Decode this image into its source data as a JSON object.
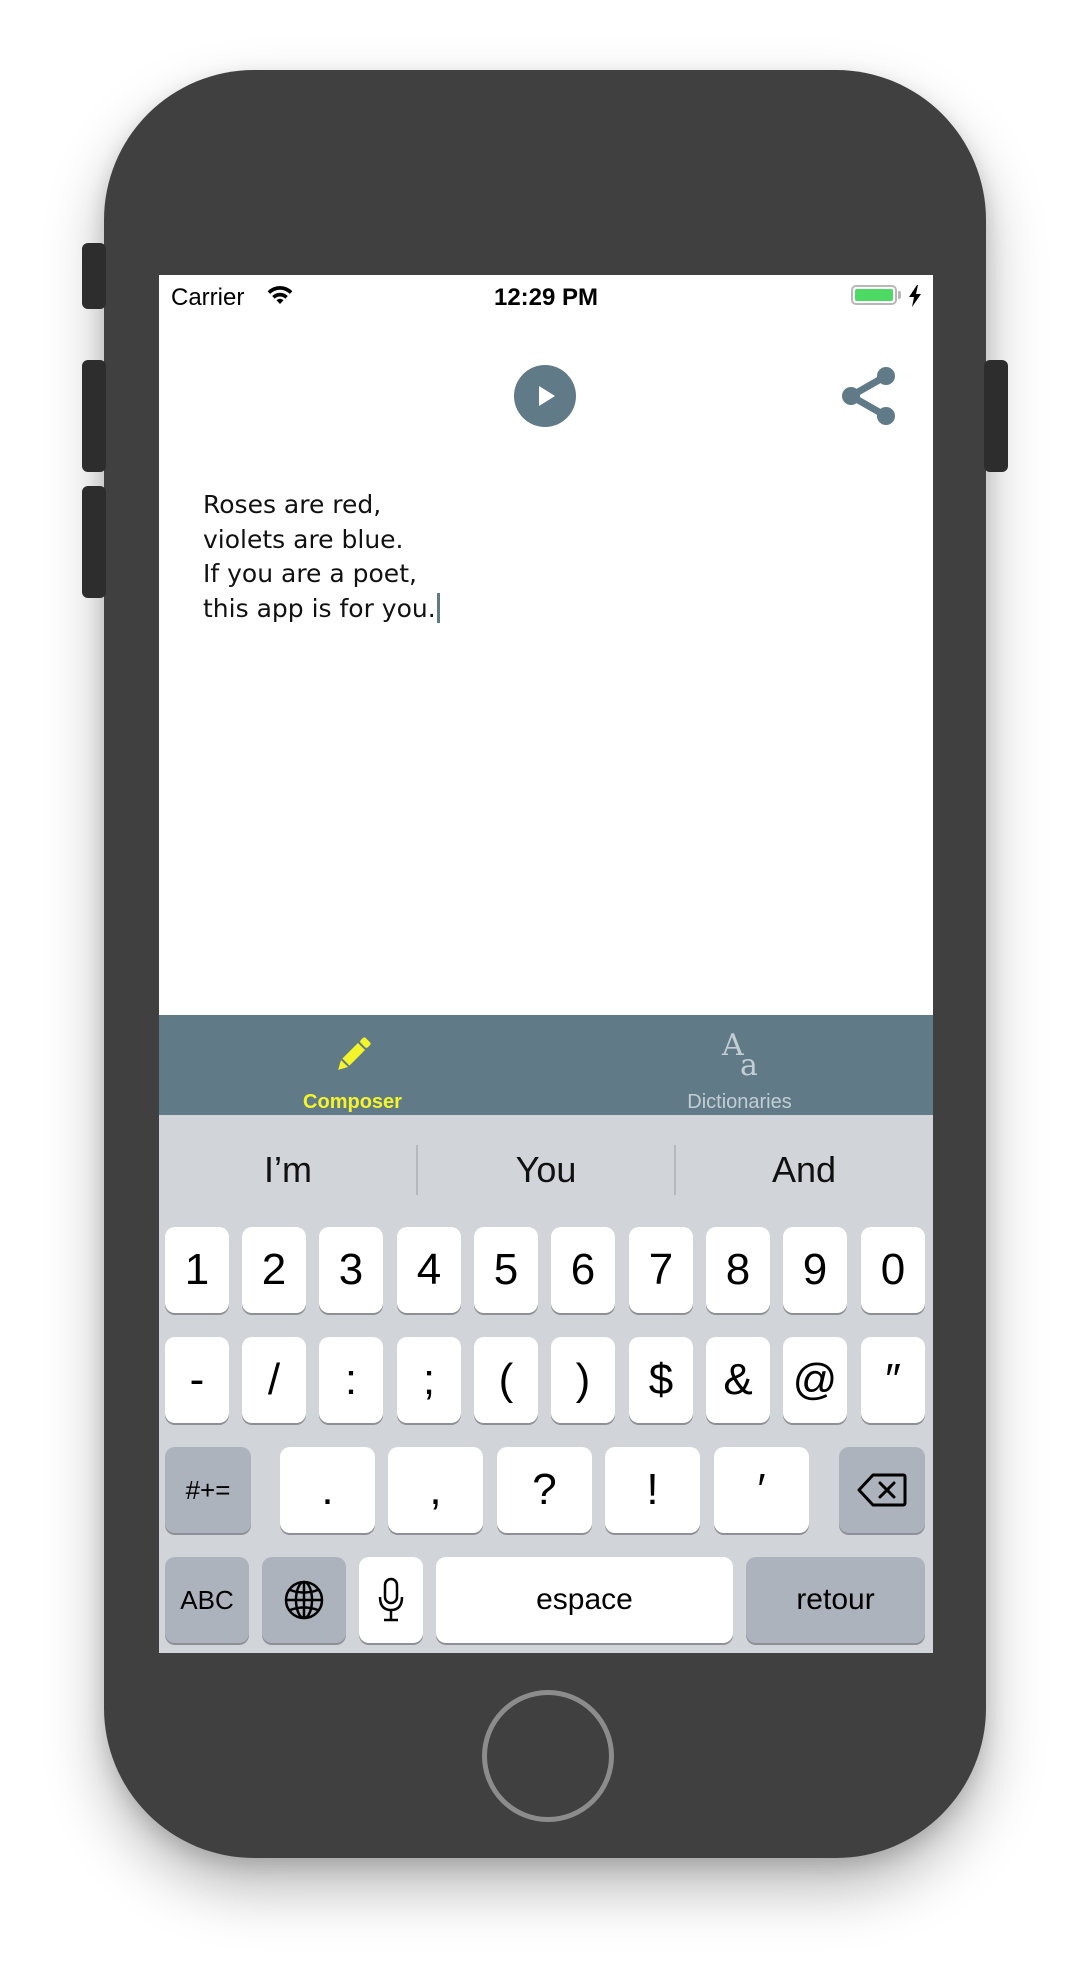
{
  "status_bar": {
    "carrier": "Carrier",
    "time": "12:29 PM",
    "wifi_icon": "wifi-icon",
    "battery_level": 1.0,
    "battery_color": "#4cd964",
    "charging_icon": "lightning-bolt-icon"
  },
  "toolbar": {
    "play_icon": "play-icon",
    "share_icon": "share-icon",
    "accent_color": "#617a87"
  },
  "composer": {
    "lines": [
      "Roses are red,",
      "violets are blue.",
      "If you are a poet,",
      "this app is for you."
    ]
  },
  "tab_bar": {
    "background": "#617a87",
    "active_color": "#f4f42a",
    "inactive_color": "#c3ced4",
    "tabs": [
      {
        "label": "Composer",
        "icon": "pencil-icon",
        "active": true
      },
      {
        "label": "Dictionaries",
        "icon": "font-size-icon",
        "icon_glyphs": [
          "A",
          "a"
        ],
        "active": false
      }
    ]
  },
  "keyboard": {
    "suggestions": [
      "I’m",
      "You",
      "And"
    ],
    "row1": [
      "1",
      "2",
      "3",
      "4",
      "5",
      "6",
      "7",
      "8",
      "9",
      "0"
    ],
    "row2": [
      "-",
      "/",
      ":",
      ";",
      "(",
      ")",
      "$",
      "&",
      "@",
      "″"
    ],
    "row3": {
      "shift_label": "#+=",
      "keys": [
        ".",
        ",",
        "?",
        "!",
        "′"
      ],
      "backspace_icon": "backspace-icon"
    },
    "row4": {
      "abc_label": "ABC",
      "globe_icon": "globe-icon",
      "mic_icon": "microphone-icon",
      "space_label": "espace",
      "return_label": "retour"
    }
  }
}
